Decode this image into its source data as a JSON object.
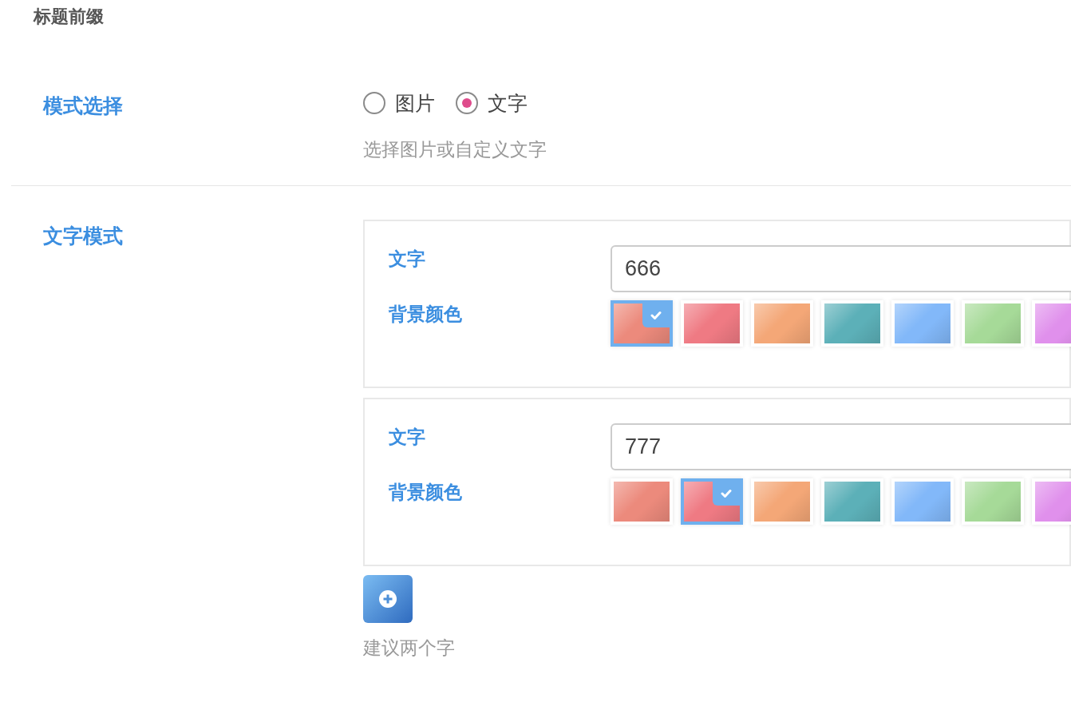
{
  "section_title": "标题前缀",
  "mode": {
    "label": "模式选择",
    "options": [
      {
        "label": "图片",
        "selected": false
      },
      {
        "label": "文字",
        "selected": true
      }
    ],
    "help": "选择图片或自定义文字"
  },
  "text_mode": {
    "label": "文字模式",
    "items": [
      {
        "text_label": "文字",
        "value": "666",
        "color_label": "背景颜色",
        "swatches": [
          {
            "color": "#ec8a7c",
            "selected": true
          },
          {
            "color": "#ef7a83",
            "selected": false
          },
          {
            "color": "#f4a777",
            "selected": false
          },
          {
            "color": "#5cb0b8",
            "selected": false
          },
          {
            "color": "#82b8f9",
            "selected": false
          },
          {
            "color": "#a6da98",
            "selected": false
          },
          {
            "color": "#e090ec",
            "selected": false
          }
        ]
      },
      {
        "text_label": "文字",
        "value": "777",
        "color_label": "背景颜色",
        "swatches": [
          {
            "color": "#ec8a7c",
            "selected": false
          },
          {
            "color": "#ef7a83",
            "selected": true
          },
          {
            "color": "#f4a777",
            "selected": false
          },
          {
            "color": "#5cb0b8",
            "selected": false
          },
          {
            "color": "#82b8f9",
            "selected": false
          },
          {
            "color": "#a6da98",
            "selected": false
          },
          {
            "color": "#e090ec",
            "selected": false
          }
        ]
      }
    ],
    "help": "建议两个字"
  }
}
